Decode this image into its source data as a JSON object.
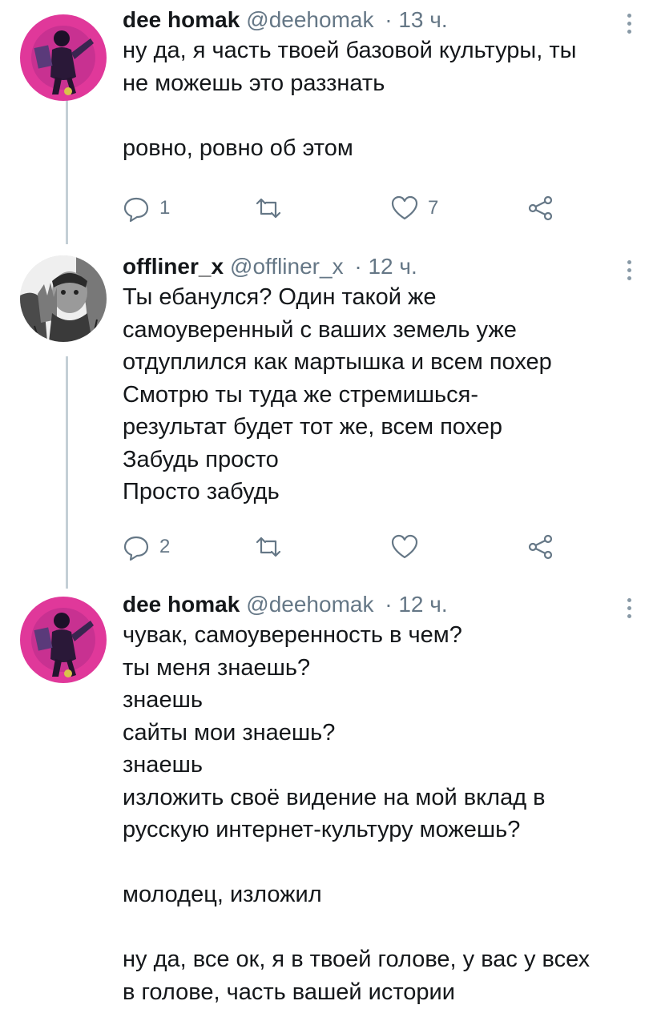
{
  "tweets": [
    {
      "name": "dee homak",
      "handle": "@deehomak",
      "time": "· 13 ч.",
      "lines": [
        "ну да, я часть твоей базовой культуры, ты",
        "не можешь это раззнать",
        "",
        "ровно, ровно об этом"
      ],
      "replies": "1",
      "retweets": "",
      "likes": "7"
    },
    {
      "name": "offliner_x",
      "handle": "@offliner_x",
      "time": "· 12 ч.",
      "lines": [
        "Ты ебанулся? Один такой же",
        "самоуверенный с ваших земель уже",
        "отдуплился как мартышка и всем похер",
        "Смотрю ты туда же стремишься-",
        "результат будет тот же, всем похер",
        "Забудь просто",
        "Просто забудь"
      ],
      "replies": "2",
      "retweets": "",
      "likes": ""
    },
    {
      "name": "dee homak",
      "handle": "@deehomak",
      "time": "· 12 ч.",
      "lines": [
        "чувак, самоуверенность в чем?",
        "ты меня знаешь?",
        "знаешь",
        "сайты мои знаешь?",
        "знаешь",
        "изложить своё видение на мой вклад в",
        "русскую интернет-культуру можешь?",
        "",
        "молодец, изложил",
        "",
        "ну да, все ок, я в твоей голове, у вас у всех",
        "в голове, часть вашей истории"
      ]
    }
  ],
  "icons": {
    "reply": "reply-icon",
    "retweet": "retweet-icon",
    "like": "heart-icon",
    "share": "share-icon",
    "more": "more-vertical-icon"
  },
  "colors": {
    "muted": "#657786",
    "thread_line": "#c4cfd6",
    "avatar_pink": "#e0389a"
  }
}
